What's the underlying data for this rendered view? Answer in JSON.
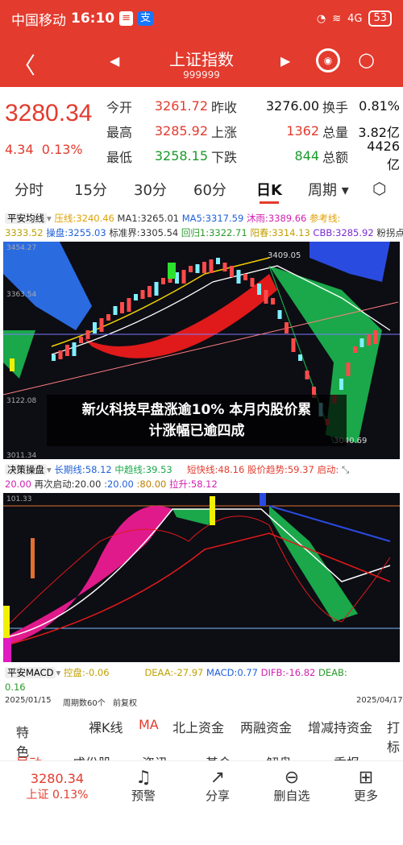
{
  "status": {
    "carrier": "中国移动",
    "time": "16:10",
    "icon1": "≡",
    "icon2": "支",
    "battery": "53",
    "signal": "4G"
  },
  "header": {
    "title": "上证指数",
    "code": "999999",
    "back": "〈",
    "prev": "◀",
    "next": "▶",
    "robot_icon": "robot-icon",
    "search_icon": "search-icon"
  },
  "quote": {
    "price": "3280.34",
    "change": "4.34",
    "change_pct": "0.13%",
    "rows": [
      [
        "今开",
        "3261.72",
        "昨收",
        "3276.00",
        "换手",
        "0.81%"
      ],
      [
        "最高",
        "3285.92",
        "上涨",
        "1362",
        "总量",
        "3.82亿"
      ],
      [
        "最低",
        "3258.15",
        "下跌",
        "844",
        "总额",
        "4426亿"
      ]
    ]
  },
  "tabs": [
    "分时",
    "15分",
    "30分",
    "60分",
    "日K",
    "周期"
  ],
  "active_tab": "日K",
  "ind1": {
    "name": "平安均线",
    "items": [
      [
        "压线:",
        "3240.46"
      ],
      [
        "MA1:",
        "3265.01"
      ],
      [
        "MA5:",
        "3317.59"
      ],
      [
        "沐雨:",
        "3389.66"
      ],
      [
        "参考线:",
        ""
      ]
    ],
    "items2": [
      [
        "",
        "3333.52"
      ],
      [
        "操盘:",
        "3255.03"
      ],
      [
        "标准界:",
        "3305.54"
      ],
      [
        "回归1:",
        "3322.71"
      ],
      [
        "阳春:",
        "3314.13"
      ],
      [
        "CBB:",
        "3285.92"
      ],
      [
        "粉拐点:",
        ""
      ]
    ]
  },
  "main_labels": {
    "top_left": "3454.27",
    "mid_left": "3363.54",
    "low_left": "3122.08",
    "bottom_left": "3011.34",
    "peak": "3409.05",
    "trough": "3040.69"
  },
  "ind2": {
    "name": "决策操盘",
    "items": [
      [
        "长期线:",
        "58.12"
      ],
      [
        "中趋线:",
        "39.53"
      ],
      [
        "短快线:",
        "48.16"
      ],
      [
        "股价趋势:",
        "59.37"
      ],
      [
        "启动:",
        ""
      ]
    ],
    "items2": [
      [
        "",
        "20.00"
      ],
      [
        "再次启动:",
        "20.00"
      ],
      [
        ":",
        "20.00"
      ],
      [
        ":",
        "80.00"
      ],
      [
        "拉升:",
        "58.12"
      ]
    ]
  },
  "sub_labels": {
    "top_left": "101.33"
  },
  "ind3": {
    "name": "平安MACD",
    "items": [
      [
        "控盘:",
        "-0.06"
      ],
      [
        "DEAA:",
        "-27.97"
      ],
      [
        "MACD:",
        "0.77"
      ],
      [
        "DIFB:",
        "-16.82"
      ],
      [
        "DEAB:",
        ""
      ]
    ],
    "extra": "0.16"
  },
  "dates": {
    "start": "2025/01/15",
    "period": "周期数60个",
    "fq": "前复权",
    "end": "2025/04/17"
  },
  "bottom_tabs": [
    "特色",
    "裸K线",
    "MA",
    "北上资金",
    "两融资金",
    "增减持资金",
    "打标"
  ],
  "bottom_active": "MA",
  "hidden_tabs": [
    "异动",
    "成份股",
    "资讯",
    "基金",
    "解盘",
    "季报"
  ],
  "nav": {
    "price": "3280.34",
    "pct_label": "上证 0.13%",
    "items": [
      "预警",
      "分享",
      "删自选",
      "更多"
    ]
  },
  "overlay": {
    "line1": "新火科技早盘涨逾10% 本月内股价累",
    "line2": "计涨幅已逾四成"
  },
  "colors": {
    "brand": "#e33b2e",
    "up": "#e33b2e",
    "down": "#1a9a2a"
  }
}
